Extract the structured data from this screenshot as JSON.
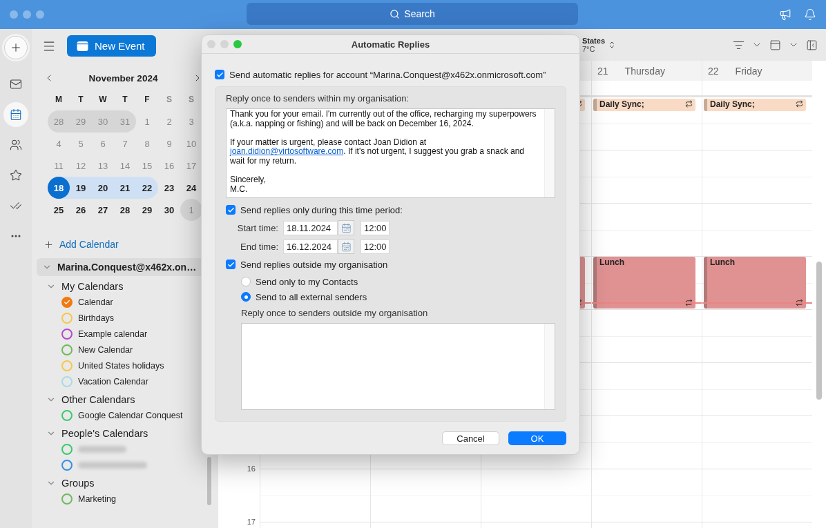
{
  "top_bar": {
    "search": {
      "placeholder": "Search"
    }
  },
  "rail": [
    {
      "kind": "mail",
      "selected": false
    },
    {
      "kind": "calendar",
      "selected": true
    },
    {
      "kind": "people",
      "selected": false
    },
    {
      "kind": "star",
      "selected": false
    },
    {
      "kind": "todo",
      "selected": false
    },
    {
      "kind": "more",
      "selected": false
    }
  ],
  "sidebar": {
    "new_event": "New Event",
    "mini_calendar": {
      "title": "November 2024",
      "weekdays": [
        {
          "label": "M",
          "weekend": false
        },
        {
          "label": "T",
          "weekend": false
        },
        {
          "label": "W",
          "weekend": false
        },
        {
          "label": "T",
          "weekend": false
        },
        {
          "label": "F",
          "weekend": false
        },
        {
          "label": "S",
          "weekend": true
        },
        {
          "label": "S",
          "weekend": true
        }
      ],
      "weeks": [
        [
          {
            "label": "28",
            "muted": true,
            "outside": true,
            "selected": false,
            "in_range": false
          },
          {
            "label": "29",
            "muted": true,
            "outside": true,
            "selected": false,
            "in_range": false
          },
          {
            "label": "30",
            "muted": true,
            "outside": true,
            "selected": false,
            "in_range": false
          },
          {
            "label": "31",
            "muted": true,
            "outside": true,
            "selected": false,
            "in_range": false
          },
          {
            "label": "1",
            "muted": true,
            "outside": false,
            "selected": false,
            "in_range": false
          },
          {
            "label": "2",
            "muted": true,
            "outside": false,
            "selected": false,
            "in_range": false
          },
          {
            "label": "3",
            "muted": true,
            "outside": false,
            "selected": false,
            "in_range": false
          }
        ],
        [
          {
            "label": "4",
            "muted": true,
            "outside": false,
            "selected": false,
            "in_range": false
          },
          {
            "label": "5",
            "muted": true,
            "outside": false,
            "selected": false,
            "in_range": false
          },
          {
            "label": "6",
            "muted": true,
            "outside": false,
            "selected": false,
            "in_range": false
          },
          {
            "label": "7",
            "muted": true,
            "outside": false,
            "selected": false,
            "in_range": false
          },
          {
            "label": "8",
            "muted": true,
            "outside": false,
            "selected": false,
            "in_range": false
          },
          {
            "label": "9",
            "muted": true,
            "outside": false,
            "selected": false,
            "in_range": false
          },
          {
            "label": "10",
            "muted": true,
            "outside": false,
            "selected": false,
            "in_range": false
          }
        ],
        [
          {
            "label": "11",
            "muted": true,
            "outside": false,
            "selected": false,
            "in_range": false
          },
          {
            "label": "12",
            "muted": true,
            "outside": false,
            "selected": false,
            "in_range": false
          },
          {
            "label": "13",
            "muted": true,
            "outside": false,
            "selected": false,
            "in_range": false
          },
          {
            "label": "14",
            "muted": true,
            "outside": false,
            "selected": false,
            "in_range": false
          },
          {
            "label": "15",
            "muted": true,
            "outside": false,
            "selected": false,
            "in_range": false
          },
          {
            "label": "16",
            "muted": true,
            "outside": false,
            "selected": false,
            "in_range": false
          },
          {
            "label": "17",
            "muted": true,
            "outside": false,
            "selected": false,
            "in_range": false
          }
        ],
        [
          {
            "label": "18",
            "muted": false,
            "outside": false,
            "selected": true,
            "in_range": true
          },
          {
            "label": "19",
            "muted": false,
            "outside": false,
            "selected": false,
            "in_range": true
          },
          {
            "label": "20",
            "muted": false,
            "outside": false,
            "selected": false,
            "in_range": true
          },
          {
            "label": "21",
            "muted": false,
            "outside": false,
            "selected": false,
            "in_range": true
          },
          {
            "label": "22",
            "muted": false,
            "outside": false,
            "selected": false,
            "in_range": true
          },
          {
            "label": "23",
            "muted": false,
            "outside": false,
            "selected": false,
            "in_range": false
          },
          {
            "label": "24",
            "muted": false,
            "outside": false,
            "selected": false,
            "in_range": false
          }
        ],
        [
          {
            "label": "25",
            "muted": false,
            "outside": false,
            "selected": false,
            "in_range": false
          },
          {
            "label": "26",
            "muted": false,
            "outside": false,
            "selected": false,
            "in_range": false
          },
          {
            "label": "27",
            "muted": false,
            "outside": false,
            "selected": false,
            "in_range": false
          },
          {
            "label": "28",
            "muted": false,
            "outside": false,
            "selected": false,
            "in_range": false
          },
          {
            "label": "29",
            "muted": false,
            "outside": false,
            "selected": false,
            "in_range": false
          },
          {
            "label": "30",
            "muted": false,
            "outside": false,
            "selected": false,
            "in_range": false
          },
          {
            "label": "1",
            "muted": true,
            "outside": true,
            "selected": false,
            "in_range": false
          }
        ]
      ]
    },
    "add_calendar": "Add Calendar",
    "account": {
      "label": "Marina.Conquest@x462x.on…",
      "expanded": true
    },
    "groups": [
      {
        "title": "My Calendars",
        "expanded": true,
        "children": [
          {
            "label": "Calendar",
            "color": "#f07a12",
            "checked": true
          },
          {
            "label": "Birthdays",
            "color": "#f5c84c",
            "checked": false
          },
          {
            "label": "Example calendar",
            "color": "#b44bc8",
            "checked": false
          },
          {
            "label": "New Calendar",
            "color": "#72b95e",
            "checked": false
          },
          {
            "label": "United States holidays",
            "color": "#f5c84c",
            "checked": false
          },
          {
            "label": "Vacation Calendar",
            "color": "#a9dbe6",
            "checked": false
          }
        ]
      },
      {
        "title": "Other Calendars",
        "expanded": true,
        "children": [
          {
            "label": "Google Calendar Conquest",
            "color": "#3cc96e",
            "checked": false
          }
        ]
      },
      {
        "title": "People's Calendars",
        "expanded": true,
        "children": [
          {
            "color": "#3cc96e",
            "checked": false,
            "redacted": true
          },
          {
            "color": "#3b8fe0",
            "checked": false,
            "redacted": true
          }
        ]
      },
      {
        "title": "Groups",
        "expanded": true,
        "children": [
          {
            "label": "Marketing",
            "color": "#72b95e",
            "checked": false
          }
        ]
      }
    ]
  },
  "main": {
    "location": {
      "title": "States",
      "temperature": "7°C"
    },
    "days": [
      {
        "events": [
          {
            "kind": "sync",
            "recurring": true
          },
          {
            "kind": "lunch",
            "recurring": true
          }
        ]
      },
      {
        "number": "21",
        "name": "Thursday",
        "events": [
          {
            "kind": "sync",
            "title": "Daily Sync;",
            "recurring": true
          },
          {
            "kind": "lunch",
            "title": "Lunch",
            "recurring": true
          }
        ]
      },
      {
        "number": "22",
        "name": "Friday",
        "events": [
          {
            "kind": "sync",
            "title": "Daily Sync;",
            "recurring": true
          },
          {
            "kind": "lunch",
            "title": "Lunch",
            "recurring": true
          }
        ]
      }
    ],
    "hours": [
      "16",
      "17"
    ]
  },
  "dialog": {
    "title": "Automatic Replies",
    "enable": {
      "label": "Send automatic replies for account “Marina.Conquest@x462x.onmicrosoft.com”",
      "checked": true
    },
    "internal": {
      "label": "Reply once to senders within my organisation:",
      "paragraphs": [
        [
          {
            "text": "Thank you for your email. I'm currently out of the office, recharging my superpowers (a.k.a. napping or fishing) and will be back on December 16, 2024."
          }
        ],
        [
          {
            "text": "If your matter is urgent, please contact Joan Didion at "
          },
          {
            "text": "joan.didion@virtosoftware.com",
            "link": true
          },
          {
            "text": ". If it's not urgent, I suggest you grab a snack and wait for my return."
          }
        ],
        [
          {
            "text": "Sincerely,\nM.C."
          }
        ]
      ]
    },
    "time_period": {
      "label": "Send replies only during this time period:",
      "checked": true,
      "start": {
        "label": "Start time:",
        "date": "18.11.2024",
        "time": "12:00"
      },
      "end": {
        "label": "End time:",
        "date": "16.12.2024",
        "time": "12:00"
      }
    },
    "external": {
      "label": "Send replies outside my organisation",
      "checked": true,
      "options": [
        {
          "label": "Send only to my Contacts",
          "selected": false
        },
        {
          "label": "Send to all external senders",
          "selected": true
        }
      ],
      "message_label": "Reply once to senders outside my organisation"
    },
    "buttons": [
      {
        "label": "Cancel",
        "kind": "secondary"
      },
      {
        "label": "OK",
        "kind": "primary"
      }
    ]
  }
}
